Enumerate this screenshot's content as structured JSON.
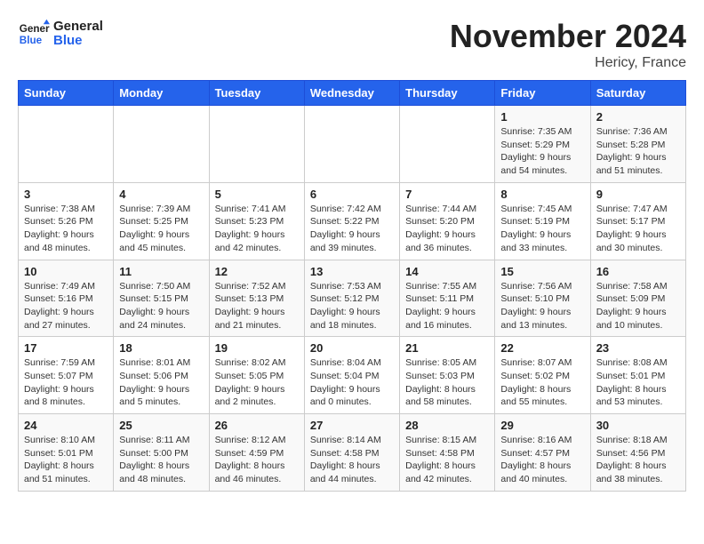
{
  "header": {
    "logo_general": "General",
    "logo_blue": "Blue",
    "month": "November 2024",
    "location": "Hericy, France"
  },
  "weekdays": [
    "Sunday",
    "Monday",
    "Tuesday",
    "Wednesday",
    "Thursday",
    "Friday",
    "Saturday"
  ],
  "weeks": [
    [
      {
        "day": "",
        "info": ""
      },
      {
        "day": "",
        "info": ""
      },
      {
        "day": "",
        "info": ""
      },
      {
        "day": "",
        "info": ""
      },
      {
        "day": "",
        "info": ""
      },
      {
        "day": "1",
        "info": "Sunrise: 7:35 AM\nSunset: 5:29 PM\nDaylight: 9 hours\nand 54 minutes."
      },
      {
        "day": "2",
        "info": "Sunrise: 7:36 AM\nSunset: 5:28 PM\nDaylight: 9 hours\nand 51 minutes."
      }
    ],
    [
      {
        "day": "3",
        "info": "Sunrise: 7:38 AM\nSunset: 5:26 PM\nDaylight: 9 hours\nand 48 minutes."
      },
      {
        "day": "4",
        "info": "Sunrise: 7:39 AM\nSunset: 5:25 PM\nDaylight: 9 hours\nand 45 minutes."
      },
      {
        "day": "5",
        "info": "Sunrise: 7:41 AM\nSunset: 5:23 PM\nDaylight: 9 hours\nand 42 minutes."
      },
      {
        "day": "6",
        "info": "Sunrise: 7:42 AM\nSunset: 5:22 PM\nDaylight: 9 hours\nand 39 minutes."
      },
      {
        "day": "7",
        "info": "Sunrise: 7:44 AM\nSunset: 5:20 PM\nDaylight: 9 hours\nand 36 minutes."
      },
      {
        "day": "8",
        "info": "Sunrise: 7:45 AM\nSunset: 5:19 PM\nDaylight: 9 hours\nand 33 minutes."
      },
      {
        "day": "9",
        "info": "Sunrise: 7:47 AM\nSunset: 5:17 PM\nDaylight: 9 hours\nand 30 minutes."
      }
    ],
    [
      {
        "day": "10",
        "info": "Sunrise: 7:49 AM\nSunset: 5:16 PM\nDaylight: 9 hours\nand 27 minutes."
      },
      {
        "day": "11",
        "info": "Sunrise: 7:50 AM\nSunset: 5:15 PM\nDaylight: 9 hours\nand 24 minutes."
      },
      {
        "day": "12",
        "info": "Sunrise: 7:52 AM\nSunset: 5:13 PM\nDaylight: 9 hours\nand 21 minutes."
      },
      {
        "day": "13",
        "info": "Sunrise: 7:53 AM\nSunset: 5:12 PM\nDaylight: 9 hours\nand 18 minutes."
      },
      {
        "day": "14",
        "info": "Sunrise: 7:55 AM\nSunset: 5:11 PM\nDaylight: 9 hours\nand 16 minutes."
      },
      {
        "day": "15",
        "info": "Sunrise: 7:56 AM\nSunset: 5:10 PM\nDaylight: 9 hours\nand 13 minutes."
      },
      {
        "day": "16",
        "info": "Sunrise: 7:58 AM\nSunset: 5:09 PM\nDaylight: 9 hours\nand 10 minutes."
      }
    ],
    [
      {
        "day": "17",
        "info": "Sunrise: 7:59 AM\nSunset: 5:07 PM\nDaylight: 9 hours\nand 8 minutes."
      },
      {
        "day": "18",
        "info": "Sunrise: 8:01 AM\nSunset: 5:06 PM\nDaylight: 9 hours\nand 5 minutes."
      },
      {
        "day": "19",
        "info": "Sunrise: 8:02 AM\nSunset: 5:05 PM\nDaylight: 9 hours\nand 2 minutes."
      },
      {
        "day": "20",
        "info": "Sunrise: 8:04 AM\nSunset: 5:04 PM\nDaylight: 9 hours\nand 0 minutes."
      },
      {
        "day": "21",
        "info": "Sunrise: 8:05 AM\nSunset: 5:03 PM\nDaylight: 8 hours\nand 58 minutes."
      },
      {
        "day": "22",
        "info": "Sunrise: 8:07 AM\nSunset: 5:02 PM\nDaylight: 8 hours\nand 55 minutes."
      },
      {
        "day": "23",
        "info": "Sunrise: 8:08 AM\nSunset: 5:01 PM\nDaylight: 8 hours\nand 53 minutes."
      }
    ],
    [
      {
        "day": "24",
        "info": "Sunrise: 8:10 AM\nSunset: 5:01 PM\nDaylight: 8 hours\nand 51 minutes."
      },
      {
        "day": "25",
        "info": "Sunrise: 8:11 AM\nSunset: 5:00 PM\nDaylight: 8 hours\nand 48 minutes."
      },
      {
        "day": "26",
        "info": "Sunrise: 8:12 AM\nSunset: 4:59 PM\nDaylight: 8 hours\nand 46 minutes."
      },
      {
        "day": "27",
        "info": "Sunrise: 8:14 AM\nSunset: 4:58 PM\nDaylight: 8 hours\nand 44 minutes."
      },
      {
        "day": "28",
        "info": "Sunrise: 8:15 AM\nSunset: 4:58 PM\nDaylight: 8 hours\nand 42 minutes."
      },
      {
        "day": "29",
        "info": "Sunrise: 8:16 AM\nSunset: 4:57 PM\nDaylight: 8 hours\nand 40 minutes."
      },
      {
        "day": "30",
        "info": "Sunrise: 8:18 AM\nSunset: 4:56 PM\nDaylight: 8 hours\nand 38 minutes."
      }
    ]
  ]
}
